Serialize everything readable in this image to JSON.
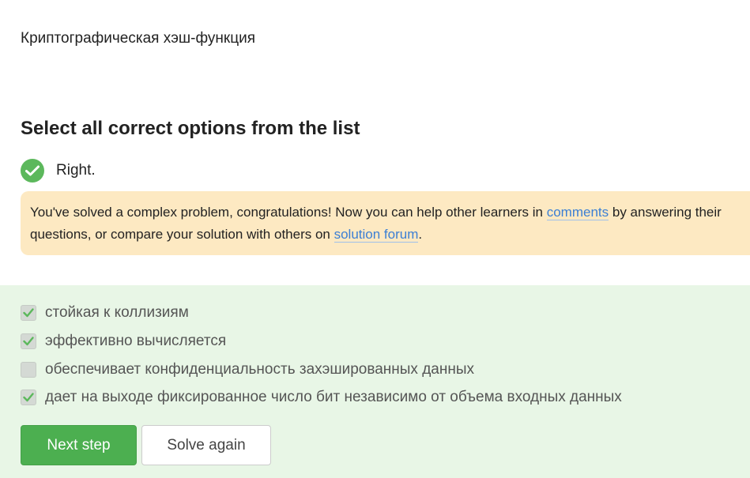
{
  "topic": "Криптографическая хэш-функция",
  "question": "Select all correct options from the list",
  "verdict": "Right.",
  "congrats": {
    "text_before": "You've solved a complex problem, congratulations! Now you can help other learners in ",
    "comments_link": "comments",
    "text_middle": " by answering their questions, or compare your solution with others on ",
    "forum_link": "solution forum",
    "text_after": "."
  },
  "options": [
    {
      "label": "стойкая к коллизиям",
      "checked": true
    },
    {
      "label": "эффективно вычисляется",
      "checked": true
    },
    {
      "label": "обеспечивает конфиденциальность захэшированных данных",
      "checked": false
    },
    {
      "label": "дает на выходе фиксированное число бит независимо от объема входных данных",
      "checked": true
    }
  ],
  "buttons": {
    "next": "Next step",
    "solve_again": "Solve again"
  },
  "colors": {
    "success": "#5cb85c",
    "panel": "#e8f6e6",
    "notice": "#fde9c2",
    "link": "#3b7fd4"
  }
}
